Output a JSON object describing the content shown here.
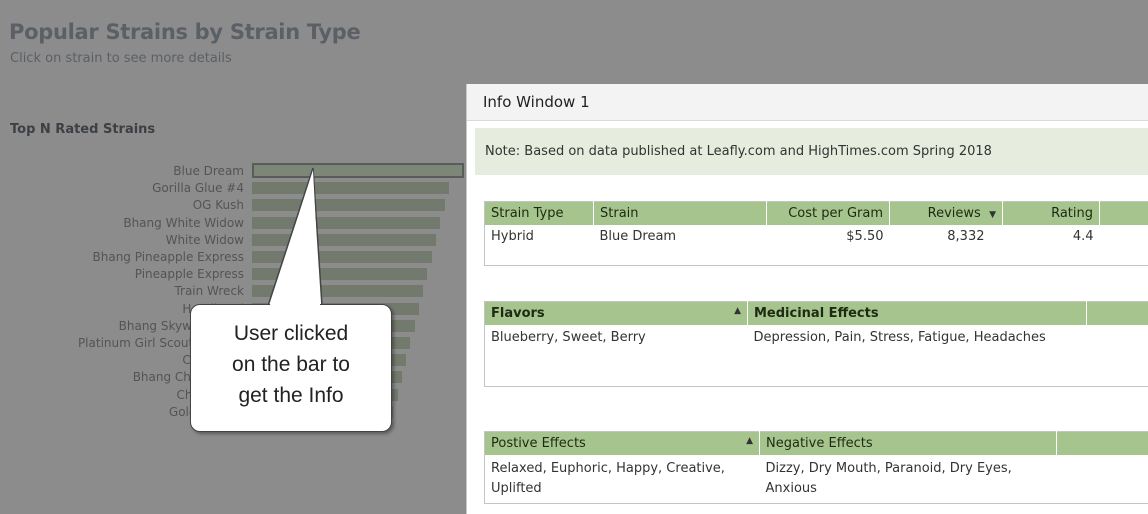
{
  "dashboard": {
    "title": "Popular Strains by Strain Type",
    "subtitle": "Click on strain to see more details",
    "section_title": "Top N Rated Strains",
    "strains": [
      {
        "label": "Blue Dream",
        "value": 0.97,
        "selected": true
      },
      {
        "label": "Gorilla Glue #4",
        "value": 0.92
      },
      {
        "label": "OG Kush",
        "value": 0.9
      },
      {
        "label": "Bhang White Widow",
        "value": 0.88
      },
      {
        "label": "White Widow",
        "value": 0.86
      },
      {
        "label": "Bhang Pineapple Express",
        "value": 0.84
      },
      {
        "label": "Pineapple Express",
        "value": 0.82
      },
      {
        "label": "Train Wreck",
        "value": 0.8
      },
      {
        "label": "Headband",
        "value": 0.78
      },
      {
        "label": "Bhang Skywalker OG",
        "value": 0.76
      },
      {
        "label": "Platinum Girl Scout Cookies",
        "value": 0.74
      },
      {
        "label": "Cherry Pie",
        "value": 0.72
      },
      {
        "label": "Bhang ChemDawg",
        "value": 0.7
      },
      {
        "label": "Chemdawg",
        "value": 0.68
      },
      {
        "label": "Golden Goat",
        "value": 0.66
      }
    ]
  },
  "callout": {
    "lines": [
      "User clicked",
      "on the bar to",
      "get the Info"
    ]
  },
  "info_window": {
    "title": "Info Window 1",
    "note": "Note: Based on data published at Leafly.com and HighTimes.com Spring 2018",
    "main_table": {
      "headers": [
        "Strain Type",
        "Strain",
        "Cost per Gram",
        "Reviews",
        "Rating"
      ],
      "row": [
        "Hybrid",
        "Blue Dream",
        "$5.50",
        "8,332",
        "4.4"
      ]
    },
    "flavors_table": {
      "headers": [
        "Flavors",
        "Medicinal Effects"
      ],
      "row": [
        "Blueberry, Sweet, Berry",
        "Depression, Pain, Stress, Fatigue, Headaches"
      ]
    },
    "effects_table": {
      "headers": [
        "Postive Effects",
        "Negative Effects"
      ],
      "row": [
        "Relaxed, Euphoric, Happy, Creative, Uplifted",
        "Dizzy, Dry Mouth, Paranoid, Dry Eyes, Anxious"
      ]
    }
  },
  "colors": {
    "overlay_bg": "#8c8c8c",
    "header_green": "#a6c48e",
    "note_bg": "#e6edde",
    "bar": "#717a6d"
  }
}
